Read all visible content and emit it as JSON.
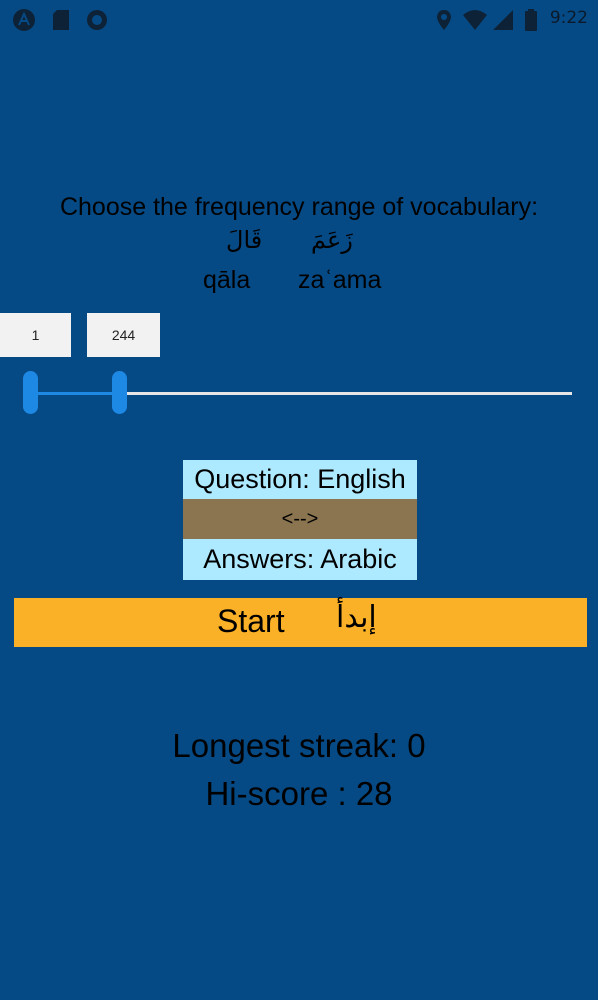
{
  "status_bar": {
    "time": "9:22",
    "left_icons": [
      "app-logo-icon",
      "sd-card-icon",
      "circle-icon"
    ],
    "right_icons": [
      "location-icon",
      "wifi-icon",
      "signal-icon",
      "battery-icon"
    ]
  },
  "range_selector": {
    "heading": "Choose the frequency range of vocabulary:",
    "low_word": {
      "arabic": "قَالَ",
      "transliteration": "qāla"
    },
    "high_word": {
      "arabic": "زَعَمَ",
      "transliteration": "zaʿama"
    },
    "min_value": "1",
    "max_value": "244",
    "slider_low_fraction": 0.0,
    "slider_high_fraction": 0.16,
    "accent_color": "#1e88e5"
  },
  "direction": {
    "question": "Question: English",
    "swap": "<-->",
    "answers": "Answers: Arabic"
  },
  "start_button": {
    "english": "Start",
    "arabic": "إبدأ",
    "color": "#fbb127"
  },
  "stats": {
    "longest_streak": "Longest streak: 0",
    "hi_score": "Hi-score : 28"
  },
  "colors": {
    "background": "#064a85",
    "direction_box": "#aeeaff",
    "swap_box": "#8b7550"
  }
}
